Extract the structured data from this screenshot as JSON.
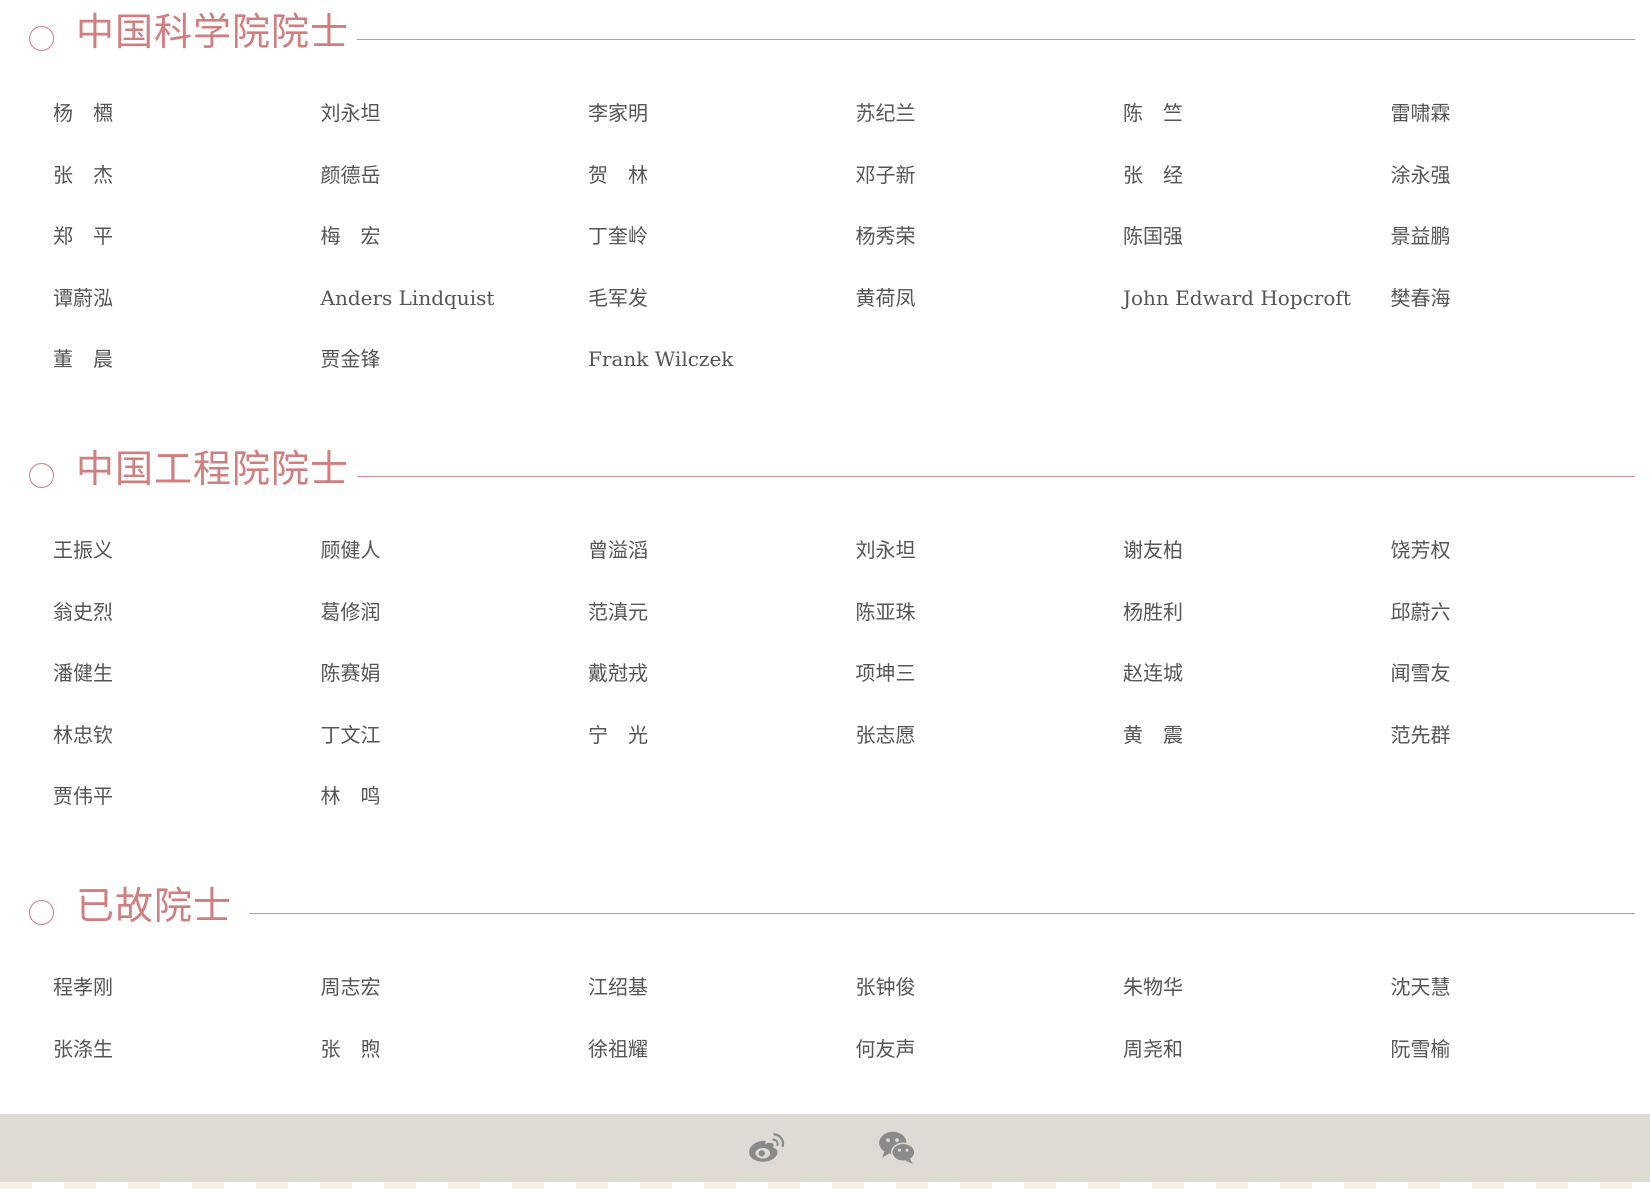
{
  "cas": {
    "title": "中国科学院院士",
    "names": [
      "杨　槱",
      "刘永坦",
      "李家明",
      "苏纪兰",
      "陈　竺",
      "雷啸霖",
      "张　杰",
      "颜德岳",
      "贺　林",
      "邓子新",
      "张　经",
      "涂永强",
      "郑　平",
      "梅　宏",
      "丁奎岭",
      "杨秀荣",
      "陈国强",
      "景益鹏",
      "谭蔚泓",
      "Anders Lindquist",
      "毛军发",
      "黄荷凤",
      "John Edward Hopcroft",
      "樊春海",
      "董　晨",
      "贾金锋",
      "Frank Wilczek"
    ]
  },
  "cae": {
    "title": "中国工程院院士",
    "names": [
      "王振义",
      "顾健人",
      "曾溢滔",
      "刘永坦",
      "谢友柏",
      "饶芳权",
      "翁史烈",
      "葛修润",
      "范滇元",
      "陈亚珠",
      "杨胜利",
      "邱蔚六",
      "潘健生",
      "陈赛娟",
      "戴尅戎",
      "项坤三",
      "赵连城",
      "闻雪友",
      "林忠钦",
      "丁文江",
      "宁　光",
      "张志愿",
      "黄　震",
      "范先群",
      "贾伟平",
      "林　鸣"
    ]
  },
  "deceased": {
    "title": "已故院士",
    "names": [
      "程孝刚",
      "周志宏",
      "江绍基",
      "张钟俊",
      "朱物华",
      "沈天慧",
      "张涤生",
      "张　煦",
      "徐祖耀",
      "何友声",
      "周尧和",
      "阮雪榆"
    ]
  },
  "footer": {
    "icons": [
      "weibo-icon",
      "wechat-icon"
    ]
  },
  "colors": {
    "accent": "#d27e7e",
    "text": "#555555",
    "footer_bg": "#dfdad3"
  }
}
